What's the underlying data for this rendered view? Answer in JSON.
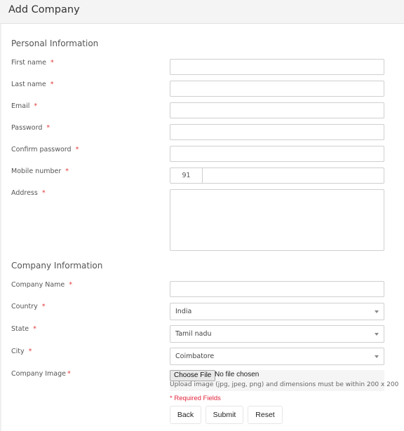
{
  "header": {
    "title": "Add Company"
  },
  "personal": {
    "title": "Personal Information",
    "fields": [
      {
        "label": "First name",
        "required": "*",
        "value": ""
      },
      {
        "label": "Last name",
        "required": "*",
        "value": ""
      },
      {
        "label": "Email",
        "required": "*",
        "value": ""
      },
      {
        "label": "Password",
        "required": "*",
        "value": ""
      },
      {
        "label": "Confirm password",
        "required": "*",
        "value": ""
      },
      {
        "label": "Mobile number",
        "required": "*",
        "code": "91",
        "value": ""
      },
      {
        "label": "Address",
        "required": "*",
        "value": ""
      }
    ]
  },
  "company": {
    "title": "Company Information",
    "fields": [
      {
        "label": "Company Name",
        "required": "*",
        "value": ""
      },
      {
        "label": "Country",
        "required": "*",
        "value": "India"
      },
      {
        "label": "State",
        "required": "*",
        "value": "Tamil nadu"
      },
      {
        "label": "City",
        "required": "*",
        "value": "Coimbatore"
      },
      {
        "label": "Company Image",
        "required": "*"
      }
    ],
    "file": {
      "button": "Choose File",
      "status": "No file chosen",
      "help": "Upload image (jpg, jpeg, png) and dimensions must be within 200 x 200"
    }
  },
  "required_note": "* Required Fields",
  "buttons": {
    "back": "Back",
    "submit": "Submit",
    "reset": "Reset"
  }
}
